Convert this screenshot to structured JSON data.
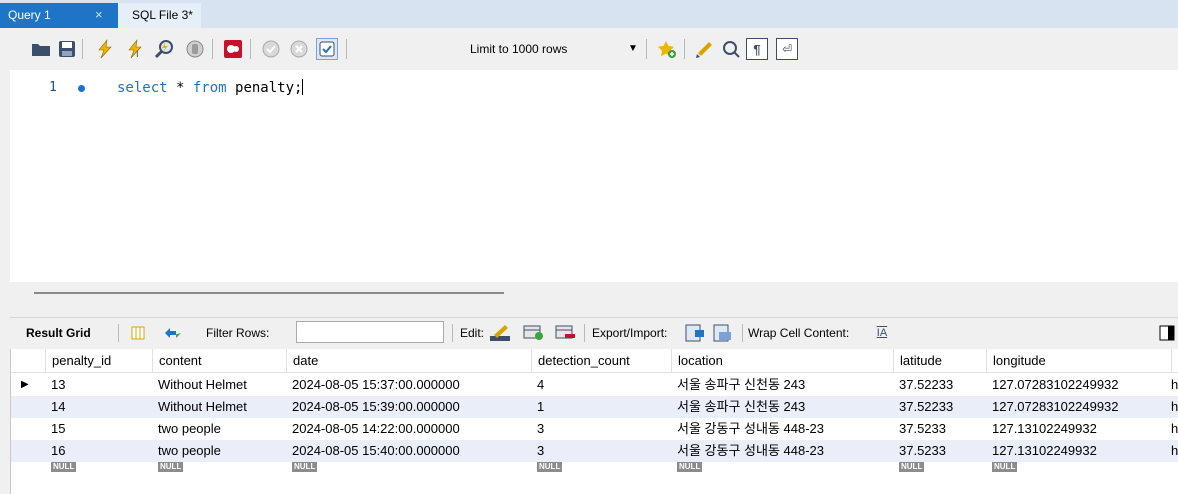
{
  "tabs": [
    {
      "label": "Query 1",
      "active": true,
      "close": "×"
    },
    {
      "label": "SQL File 3*",
      "active": false
    }
  ],
  "toolbar": {
    "limit_select": "Limit to 1000 rows",
    "colors": {
      "folder": "#3c4f6a",
      "lightning": "#f0b400",
      "stop": "#c8102e",
      "accent": "#1e74c7"
    }
  },
  "editor": {
    "line_number": "1",
    "tokens": [
      {
        "text": "select",
        "kw": true
      },
      {
        "text": " * ",
        "kw": false
      },
      {
        "text": "from",
        "kw": true
      },
      {
        "text": " penalty;",
        "kw": false
      }
    ]
  },
  "result_toolbar": {
    "result_grid": "Result Grid",
    "filter_rows": "Filter Rows:",
    "edit": "Edit:",
    "export_import": "Export/Import:",
    "wrap_cell": "Wrap Cell Content:"
  },
  "grid": {
    "columns": [
      "penalty_id",
      "content",
      "date",
      "detection_count",
      "location",
      "latitude",
      "longitude"
    ],
    "rows": [
      [
        "13",
        "Without Helmet",
        "2024-08-05 15:37:00.000000",
        "4",
        "서울 송파구 신천동 243",
        "37.52233",
        "127.07283102249932",
        "h"
      ],
      [
        "14",
        "Without Helmet",
        "2024-08-05 15:39:00.000000",
        "1",
        "서울 송파구 신천동 243",
        "37.52233",
        "127.07283102249932",
        "h"
      ],
      [
        "15",
        "two people",
        "2024-08-05 14:22:00.000000",
        "3",
        "서울 강동구 성내동 448-23",
        "37.5233",
        "127.13102249932",
        "h"
      ],
      [
        "16",
        "two people",
        "2024-08-05 15:40:00.000000",
        "3",
        "서울 강동구 성내동 448-23",
        "37.5233",
        "127.13102249932",
        "h"
      ]
    ],
    "null_label": "NULL",
    "current_row_marker": "▶"
  }
}
